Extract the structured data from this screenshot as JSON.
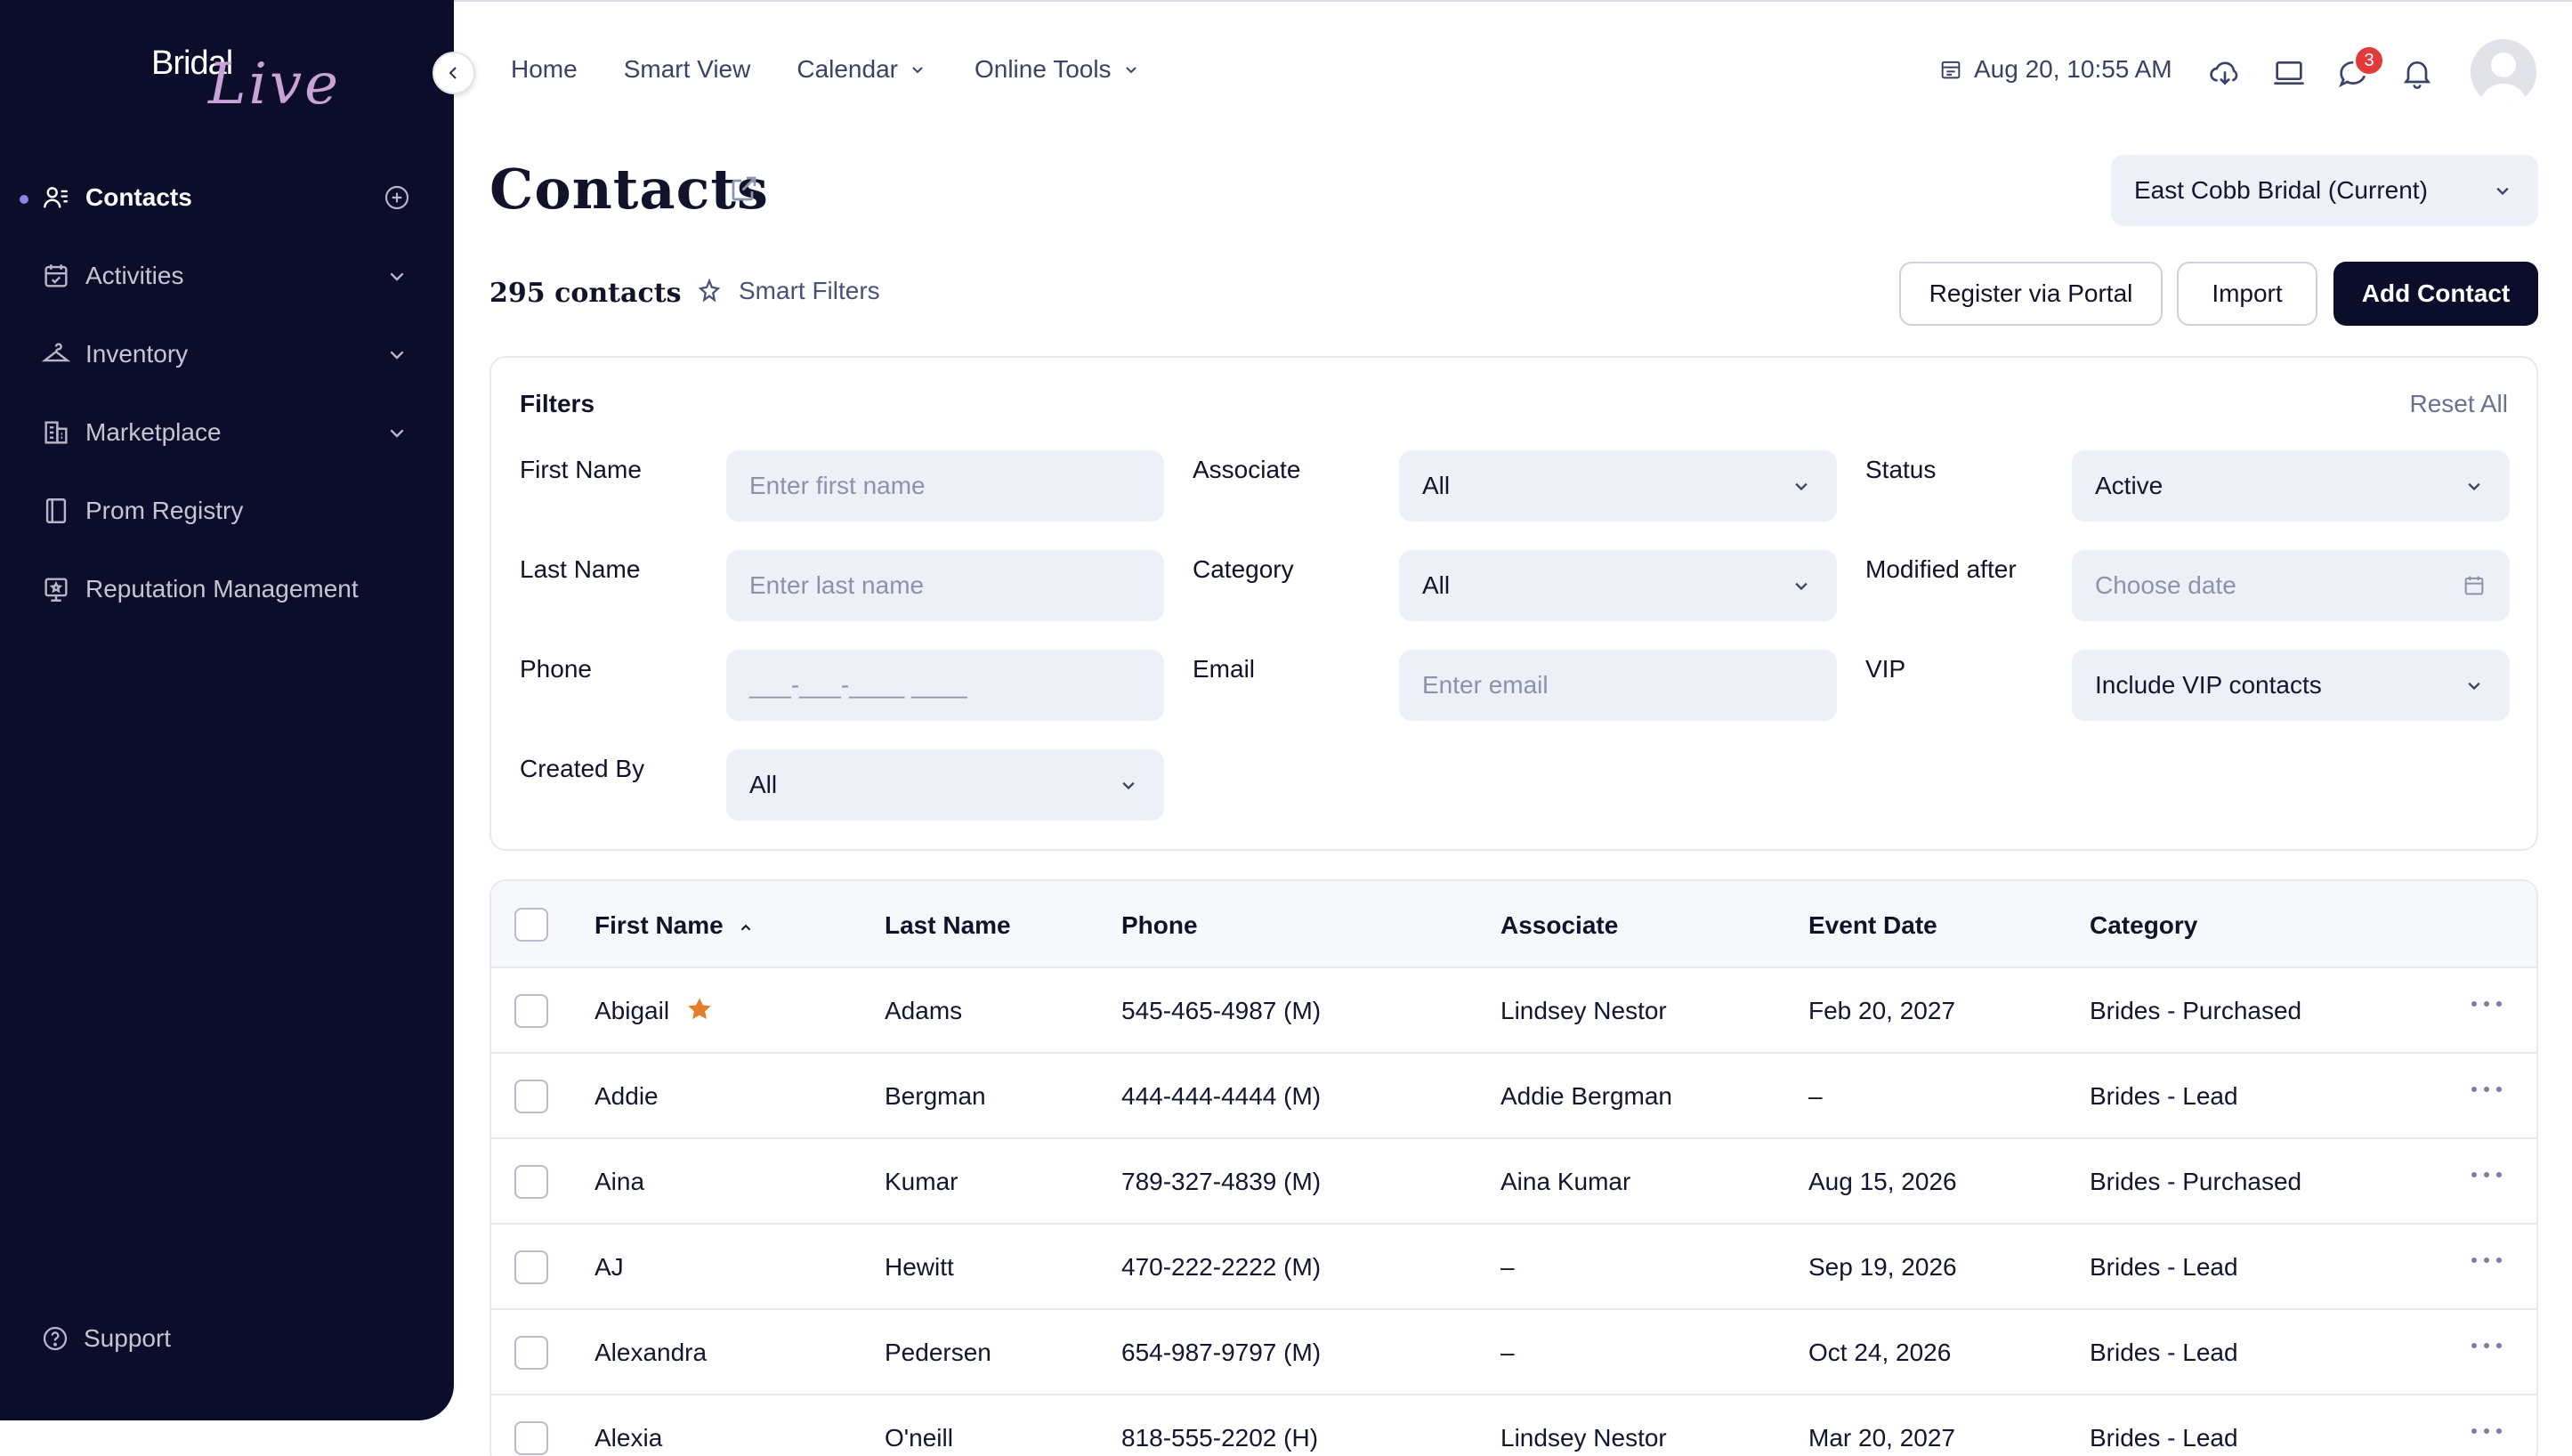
{
  "app": {
    "brand_primary": "Bridal",
    "brand_script": "Live",
    "colors": {
      "sidebar": "#0c0d2a",
      "accent": "#8d84e6",
      "badge": "#e23a3a",
      "star": "#e47c2b"
    }
  },
  "sidebar": {
    "items": [
      {
        "label": "Contacts",
        "icon": "contacts-icon",
        "active": true
      },
      {
        "label": "Activities",
        "icon": "calendar-check-icon"
      },
      {
        "label": "Inventory",
        "icon": "hanger-icon"
      },
      {
        "label": "Marketplace",
        "icon": "building-icon"
      },
      {
        "label": "Prom Registry",
        "icon": "registry-book-icon"
      },
      {
        "label": "Reputation Management",
        "icon": "review-icon"
      }
    ],
    "support_label": "Support"
  },
  "topnav": {
    "items": [
      {
        "label": "Home"
      },
      {
        "label": "Smart View"
      },
      {
        "label": "Calendar"
      },
      {
        "label": "Online Tools"
      }
    ],
    "datetime": "Aug 20, 10:55 AM",
    "notifications_count": "3"
  },
  "header": {
    "title": "Contacts",
    "store_selector": "East Cobb Bridal (Current)",
    "count": "295 contacts",
    "smart_filters": "Smart Filters",
    "register_button": "Register via Portal",
    "import_button": "Import",
    "add_button": "Add Contact"
  },
  "filters": {
    "title": "Filters",
    "reset": "Reset All",
    "first_name": {
      "label": "First Name",
      "placeholder": "Enter first name"
    },
    "last_name": {
      "label": "Last Name",
      "placeholder": "Enter last name"
    },
    "phone": {
      "label": "Phone",
      "placeholder": "___-___-____ ____"
    },
    "created_by": {
      "label": "Created By",
      "value": "All"
    },
    "associate": {
      "label": "Associate",
      "value": "All"
    },
    "category": {
      "label": "Category",
      "value": "All"
    },
    "email": {
      "label": "Email",
      "placeholder": "Enter email"
    },
    "status": {
      "label": "Status",
      "value": "Active"
    },
    "modified_after": {
      "label": "Modified after",
      "placeholder": "Choose date"
    },
    "vip": {
      "label": "VIP",
      "value": "Include VIP contacts"
    }
  },
  "table": {
    "columns": [
      "First Name",
      "Last Name",
      "Phone",
      "Associate",
      "Event Date",
      "Category"
    ],
    "rows": [
      {
        "first": "Abigail",
        "vip": true,
        "last": "Adams",
        "phone": "545-465-4987 (M)",
        "associate": "Lindsey Nestor",
        "event": "Feb 20, 2027",
        "category": "Brides - Purchased"
      },
      {
        "first": "Addie",
        "vip": false,
        "last": "Bergman",
        "phone": "444-444-4444 (M)",
        "associate": "Addie Bergman",
        "event": "–",
        "category": "Brides - Lead"
      },
      {
        "first": "Aina",
        "vip": false,
        "last": "Kumar",
        "phone": "789-327-4839 (M)",
        "associate": "Aina Kumar",
        "event": "Aug 15, 2026",
        "category": "Brides - Purchased"
      },
      {
        "first": "AJ",
        "vip": false,
        "last": "Hewitt",
        "phone": "470-222-2222 (M)",
        "associate": "–",
        "event": "Sep 19, 2026",
        "category": "Brides - Lead"
      },
      {
        "first": "Alexandra",
        "vip": false,
        "last": "Pedersen",
        "phone": "654-987-9797 (M)",
        "associate": "–",
        "event": "Oct 24, 2026",
        "category": "Brides - Lead"
      },
      {
        "first": "Alexia",
        "vip": false,
        "last": "O'neill",
        "phone": "818-555-2202 (H)",
        "associate": "Lindsey Nestor",
        "event": "Mar 20, 2027",
        "category": "Brides - Lead"
      }
    ]
  }
}
